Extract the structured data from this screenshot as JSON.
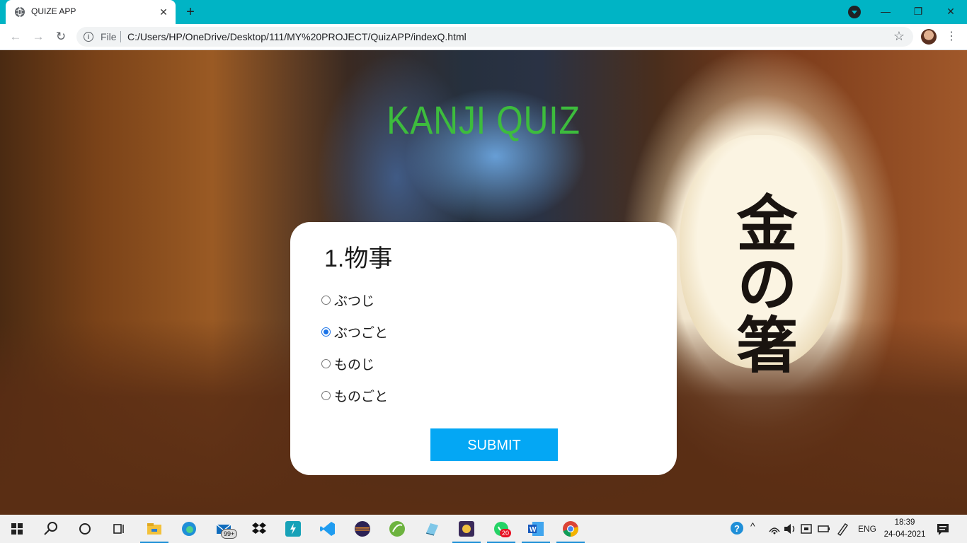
{
  "browser": {
    "tab_title": "QUIZE APP",
    "tab_close": "✕",
    "new_tab": "+",
    "window_controls": [
      "—",
      "❐",
      "✕"
    ],
    "nav": {
      "back": "←",
      "forward": "→",
      "reload": "↻"
    },
    "file_label": "File",
    "url": "C:/Users/HP/OneDrive/Desktop/111/MY%20PROJECT/QuizAPP/indexQ.html",
    "star": "☆",
    "menu": "⋮"
  },
  "page": {
    "title": "KANJI QUIZ",
    "lantern_text": "金の箸",
    "question": "1.物事",
    "options": [
      {
        "label": "ぶつじ",
        "checked": false
      },
      {
        "label": "ぶつごと",
        "checked": true
      },
      {
        "label": "ものじ",
        "checked": false
      },
      {
        "label": "ものごと",
        "checked": false
      }
    ],
    "submit_label": "SUBMIT"
  },
  "taskbar": {
    "apps": [
      "windows-start",
      "search",
      "cortana",
      "task-view",
      "file-explorer",
      "edge",
      "mail",
      "dropbox",
      "slack-like",
      "vscode",
      "eclipse",
      "spring",
      "notepad",
      "game",
      "whatsapp",
      "word",
      "chrome"
    ],
    "mail_badge": "99+",
    "whatsapp_badge": "20",
    "language": "ENG",
    "time": "18:39",
    "date": "24-04-2021"
  },
  "colors": {
    "tabstrip": "#00b4c5",
    "title_green": "#3dbc3d",
    "submit_blue": "#04a7f4",
    "radio_selected": "#1a73e8"
  }
}
